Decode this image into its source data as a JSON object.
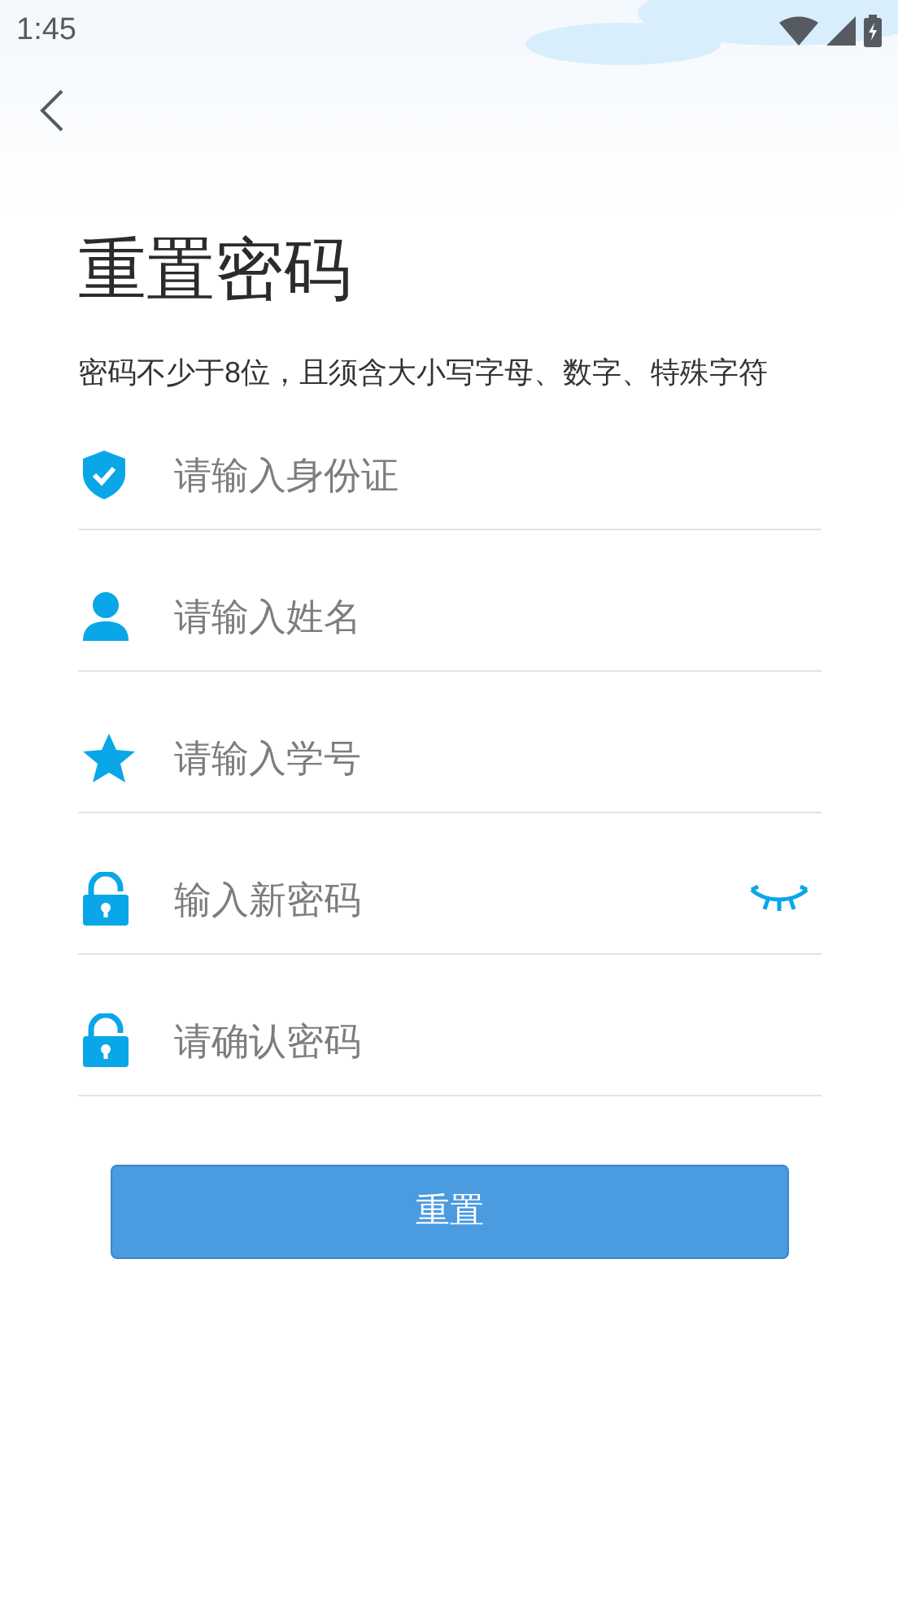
{
  "status_bar": {
    "time": "1:45"
  },
  "title": "重置密码",
  "hint": "密码不少于8位，且须含大小写字母、数字、特殊字符",
  "fields": [
    {
      "kind": "idcard",
      "placeholder": "请输入身份证"
    },
    {
      "kind": "name",
      "placeholder": "请输入姓名"
    },
    {
      "kind": "number",
      "placeholder": "请输入学号"
    },
    {
      "kind": "password",
      "placeholder": "输入新密码"
    },
    {
      "kind": "confirm",
      "placeholder": "请确认密码"
    }
  ],
  "button": "重置"
}
